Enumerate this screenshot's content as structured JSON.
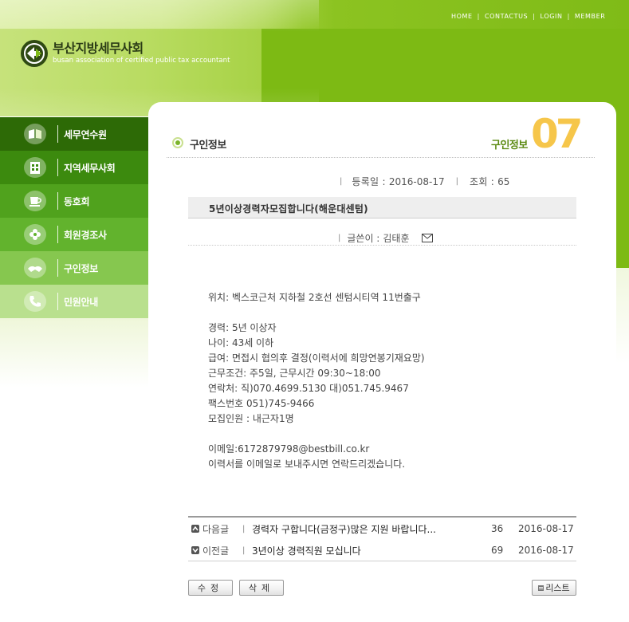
{
  "top_nav": [
    "HOME",
    "CONTACTUS",
    "LOGIN",
    "MEMBER"
  ],
  "logo": {
    "title": "부산지방세무사회",
    "subtitle": "busan association of certified public tax accountant"
  },
  "side_menu": [
    {
      "label": "세무연수원",
      "icon": "book-icon",
      "bg": "#2d6a06"
    },
    {
      "label": "지역세무사회",
      "icon": "building-icon",
      "bg": "#3c8a0e"
    },
    {
      "label": "동호회",
      "icon": "cup-icon",
      "bg": "#50a21d"
    },
    {
      "label": "회원경조사",
      "icon": "flower-icon",
      "bg": "#62b32d"
    },
    {
      "label": "구인정보",
      "icon": "hands-icon",
      "bg": "#86c74f"
    },
    {
      "label": "민원안내",
      "icon": "phone-icon",
      "bg": "#b9e08e"
    }
  ],
  "page_header": {
    "title": "구인정보",
    "right_label": "구인정보",
    "number": "07"
  },
  "post": {
    "date_label": "등록일 :",
    "date": "2016-08-17",
    "views_label": "조회 :",
    "views": "65",
    "title": "5년이상경력자모집합니다(해운대센텀)",
    "author_label": "글쓴이 :",
    "author": "김태훈",
    "body": [
      "위치: 벡스코근처 지하철 2호선 센텀시티역 11번출구",
      "",
      "경력: 5년 이상자",
      "나이: 43세 이하",
      "급여: 면접시 협의후 결정(이력서에 희망연봉기재요망)",
      "근무조건: 주5일, 근무시간 09:30~18:00",
      "연락처: 직)070.4699.5130 대)051.745.9467",
      "팩스번호 051)745-9466",
      "모집인원 : 내근자1명",
      "",
      "이메일:6172879798@bestbill.co.kr",
      "이력서를 이메일로 보내주시면 연락드리겠습니다."
    ]
  },
  "nav_posts": [
    {
      "kind": "다음글",
      "title": "경력자 구합니다(금정구)많은 지원 바랍니다...",
      "hits": "36",
      "date": "2016-08-17"
    },
    {
      "kind": "이전글",
      "title": "3년이상 경력직원 모십니다",
      "hits": "69",
      "date": "2016-08-17"
    }
  ],
  "buttons": {
    "edit": "수정",
    "delete": "삭제",
    "list": "리스트"
  },
  "colors": {
    "header_green": "#7fbb17",
    "accent_yellow": "#f6c64a",
    "accent_dark_green": "#5c8a12"
  }
}
